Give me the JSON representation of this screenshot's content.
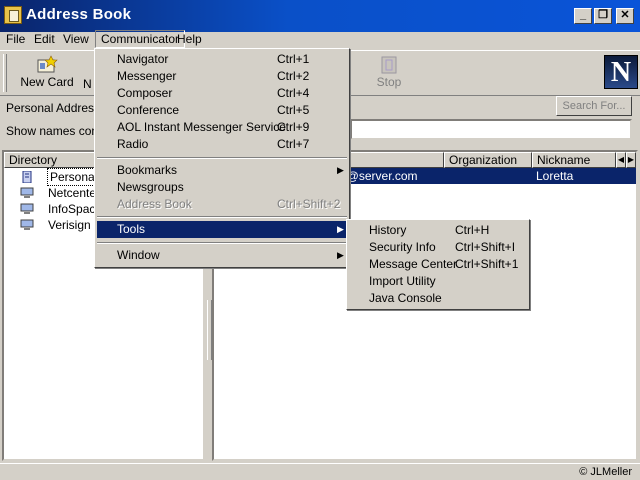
{
  "window": {
    "title": "Address Book"
  },
  "menubar": [
    "File",
    "Edit",
    "View",
    "Communicator",
    "Help"
  ],
  "toolbar": {
    "buttons": [
      {
        "label": "New Card",
        "icon": "new-card-icon"
      },
      {
        "label": "N",
        "icon": "new-list-icon"
      },
      {
        "label": "Stop",
        "icon": "stop-icon"
      }
    ],
    "logo": "N"
  },
  "address": {
    "pab_label": "Personal Address E",
    "search_button": "Search For...",
    "show_label": "Show names conta",
    "show_value": ""
  },
  "directory": {
    "header": "Directory",
    "items": [
      "Personal A",
      "Netcenter",
      "InfoSpace",
      "Verisign D"
    ]
  },
  "list": {
    "columns": [
      "",
      "Organization",
      "Nickname"
    ],
    "selected_row": {
      "email": "e@server.com",
      "organization": "",
      "nickname": "Loretta"
    }
  },
  "communicator_menu": {
    "group1": [
      {
        "label": "Navigator",
        "shortcut": "Ctrl+1"
      },
      {
        "label": "Messenger",
        "shortcut": "Ctrl+2"
      },
      {
        "label": "Composer",
        "shortcut": "Ctrl+4"
      },
      {
        "label": "Conference",
        "shortcut": "Ctrl+5"
      },
      {
        "label": "AOL Instant Messenger Service",
        "shortcut": "Ctrl+9"
      },
      {
        "label": "Radio",
        "shortcut": "Ctrl+7"
      }
    ],
    "group2": [
      {
        "label": "Bookmarks",
        "shortcut": ""
      },
      {
        "label": "Newsgroups",
        "shortcut": ""
      },
      {
        "label": "Address Book",
        "shortcut": "Ctrl+Shift+2"
      }
    ],
    "tools": "Tools",
    "window": "Window"
  },
  "tools_menu": [
    {
      "label": "History",
      "shortcut": "Ctrl+H"
    },
    {
      "label": "Security Info",
      "shortcut": "Ctrl+Shift+I"
    },
    {
      "label": "Message Center",
      "shortcut": "Ctrl+Shift+1"
    },
    {
      "label": "Import Utility",
      "shortcut": ""
    },
    {
      "label": "Java Console",
      "shortcut": ""
    }
  ],
  "status": {
    "copyright": "© JLMeller"
  }
}
